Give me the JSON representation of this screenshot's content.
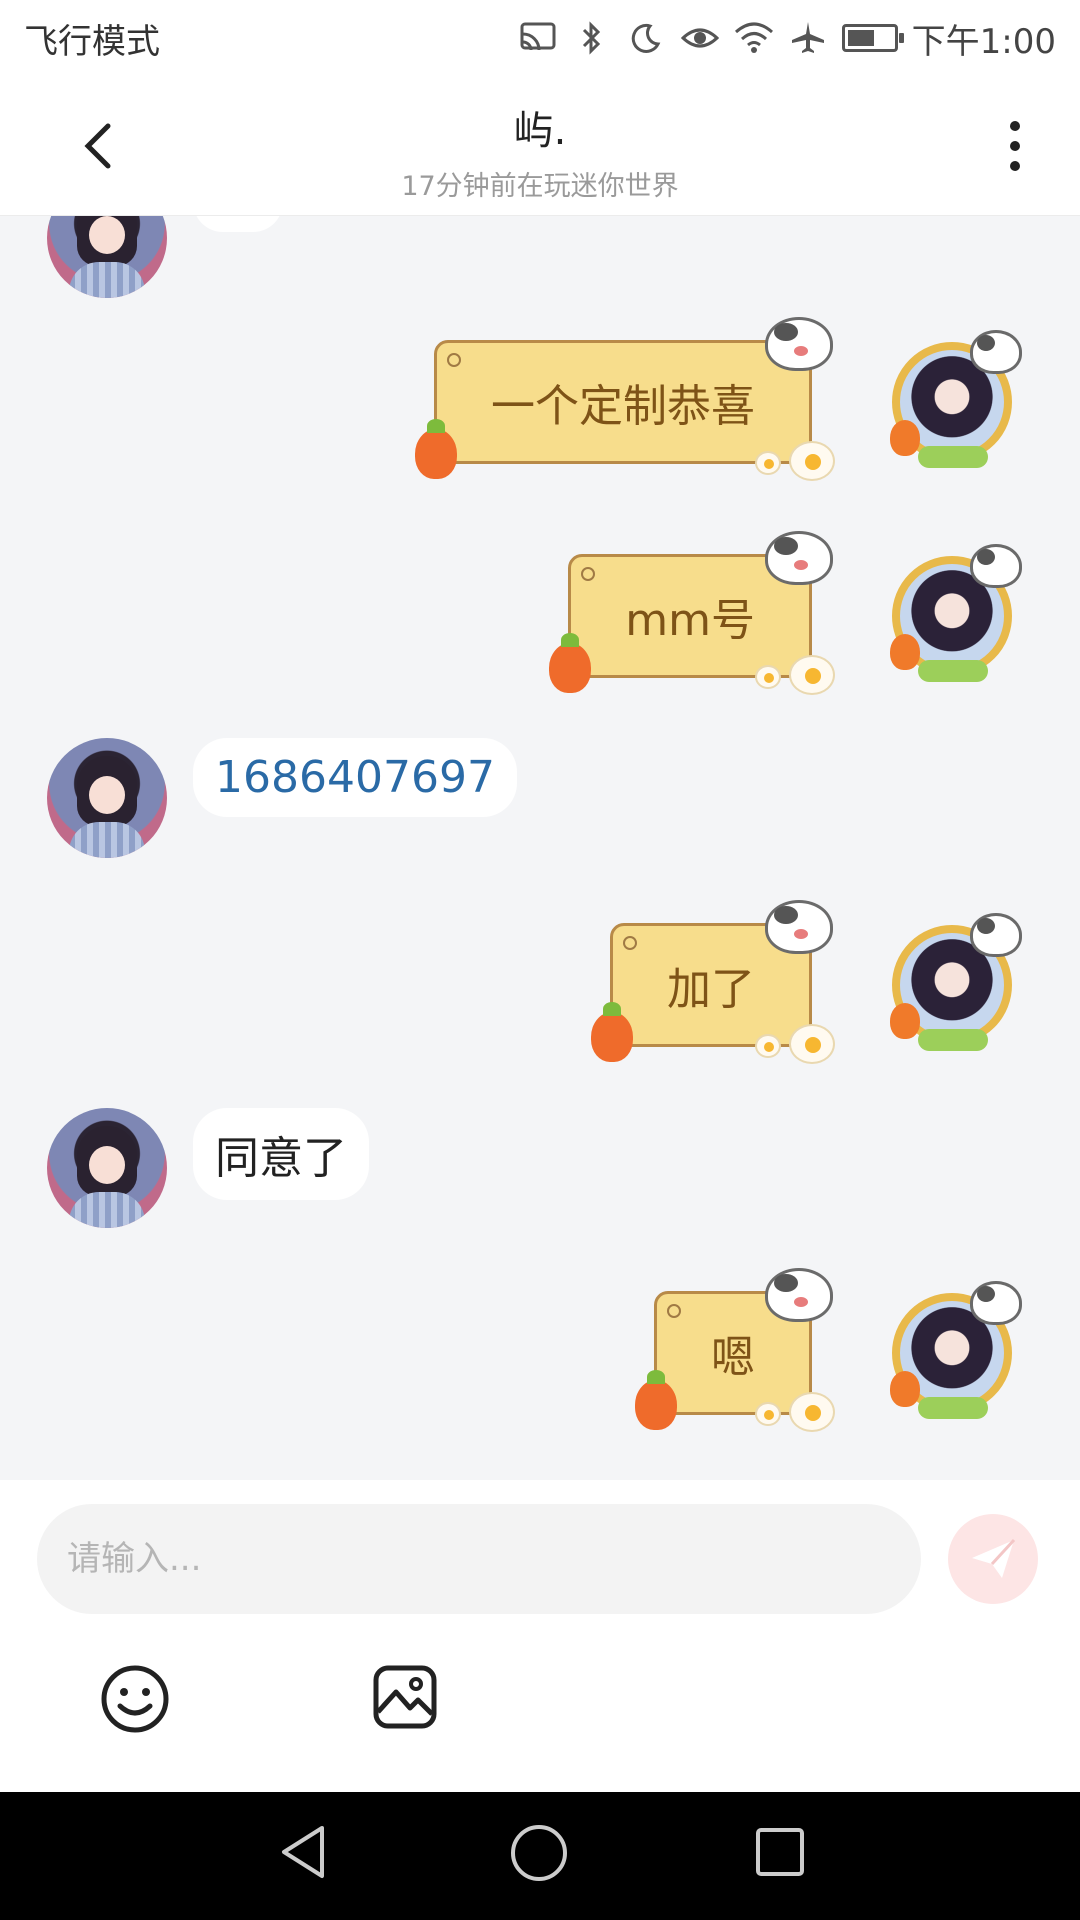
{
  "status_bar": {
    "left_text": "飞行模式",
    "time": "下午1:00",
    "icons": [
      "cast-icon",
      "bluetooth-icon",
      "moon-icon",
      "eye-icon",
      "wifi-icon",
      "airplane-icon",
      "battery-icon"
    ]
  },
  "header": {
    "title": "屿.",
    "subtitle": "17分钟前在玩迷你世界"
  },
  "messages": [
    {
      "side": "left",
      "text": ""
    },
    {
      "side": "right",
      "text": "一个定制恭喜"
    },
    {
      "side": "right",
      "text": "mm号"
    },
    {
      "side": "left",
      "text": "1686407697",
      "style": "number"
    },
    {
      "side": "right",
      "text": "加了"
    },
    {
      "side": "left",
      "text": "同意了"
    },
    {
      "side": "right",
      "text": "嗯"
    }
  ],
  "input": {
    "placeholder": "请输入..."
  },
  "colors": {
    "chat_bg": "#f4f5f7",
    "right_bubble": "#f7dd8c",
    "right_bubble_text": "#7e5317",
    "number_text": "#2a6aa6",
    "send_button": "#fde5e5"
  }
}
